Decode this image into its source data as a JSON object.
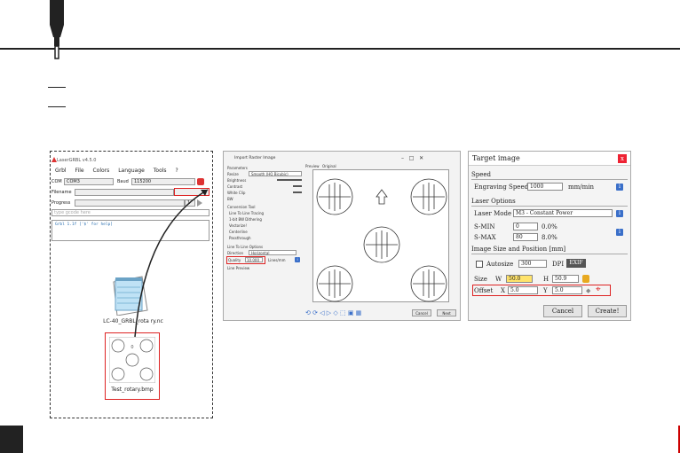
{
  "lasergrbl": {
    "title": "LaserGRBL v4.5.0",
    "menu": [
      "Grbl",
      "File",
      "Colors",
      "Language",
      "Tools",
      "?"
    ],
    "com_label": "COM",
    "com_value": "COM3",
    "baud_label": "Baud",
    "baud_value": "115200",
    "filename_label": "Filename",
    "progress_label": "Progress",
    "progress_value": "1",
    "console_placeholder": "type gcode here",
    "console_line": "Grbl 1.1f ['$' for help]"
  },
  "desktop": {
    "notepad_label": "LC-40_GRBL_rota ry.nc",
    "bmp_label": "Test_rotary.bmp"
  },
  "import_dialog": {
    "title": "Import Raster Image",
    "parameters": "Parameters",
    "resize_label": "Resize",
    "resize_value": "Smooth (HQ Bicubic)",
    "brightness": "Brightness",
    "contrast": "Contrast",
    "white_clip": "White Clip",
    "dither": "BW",
    "conversion_tool": "Conversion Tool",
    "opt_line": "Line To Line Tracing",
    "opt_dither": "1-bit BW Dithering",
    "opt_vectorize": "Vectorize!",
    "opt_centerline": "Centerline",
    "opt_passthrough": "Passthrough",
    "line_options": "Line To Line Options",
    "direction_label": "Direction",
    "direction_value": "Horizontal",
    "quality_label": "Quality",
    "quality_value": "10.000",
    "quality_unit": "Lines/mm",
    "line_preview": "Line Preview",
    "preview_label": "Preview",
    "original_label": "Original",
    "cancel": "Cancel",
    "next": "Next"
  },
  "target_dialog": {
    "title": "Target image",
    "speed_section": "Speed",
    "engraving_speed_label": "Engraving Speed",
    "engraving_speed_value": "1000",
    "speed_unit": "mm/min",
    "laser_section": "Laser Options",
    "laser_mode_label": "Laser Mode",
    "laser_mode_value": "M3 - Constant Power",
    "smin_label": "S-MIN",
    "smin_value": "0",
    "smin_pct": "0.0%",
    "smax_label": "S-MAX",
    "smax_value": "80",
    "smax_pct": "8.0%",
    "size_section": "Image Size and Position [mm]",
    "autosize_label": "Autosize",
    "autosize_value": "300",
    "dpi_label": "DPI",
    "exif_label": "EXIF",
    "size_label": "Size",
    "w_label": "W",
    "w_value": "50.0",
    "h_label": "H",
    "h_value": "50.9",
    "offset_label": "Offset",
    "x_label": "X",
    "x_value": "5.0",
    "y_label": "Y",
    "y_value": "5.0",
    "cancel": "Cancel",
    "create": "Create!"
  }
}
